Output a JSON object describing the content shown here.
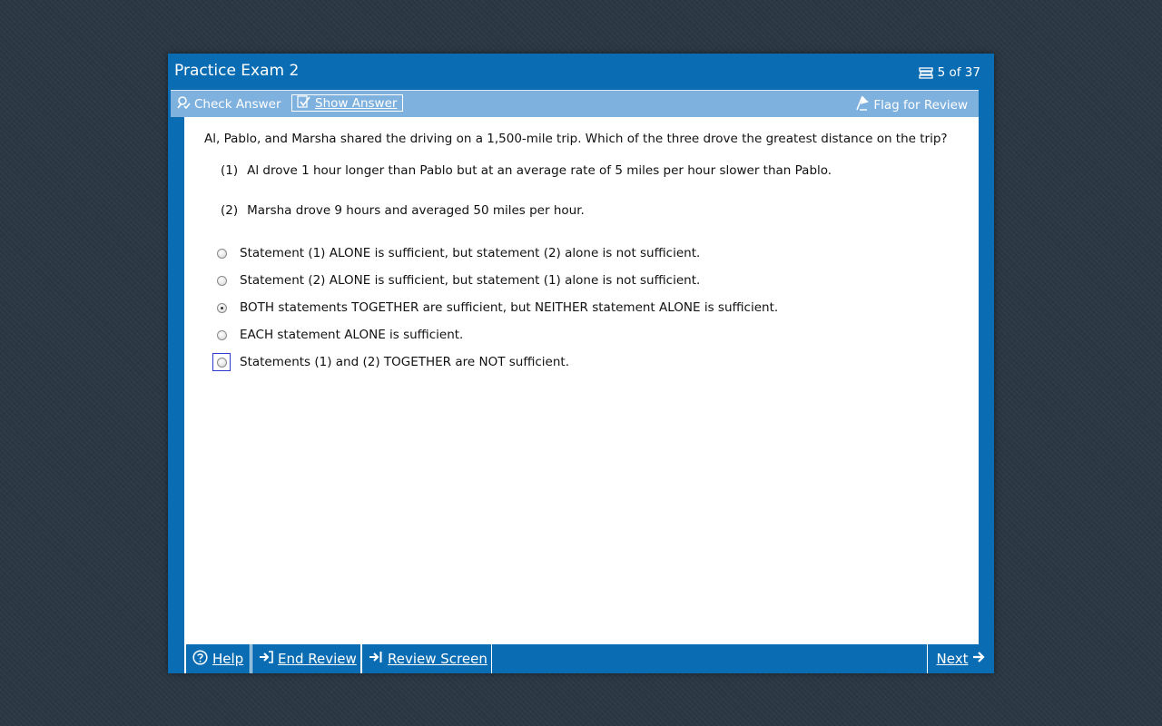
{
  "window": {
    "title": "Practice Exam 2",
    "counter": "5 of 37"
  },
  "toolbar": {
    "check_answer": "Check Answer",
    "show_answer": "Show Answer",
    "flag_for_review": "Flag for Review"
  },
  "question": {
    "text": "Al, Pablo, and Marsha shared the driving on a 1,500-mile trip. Which of the three drove the greatest distance on the trip?",
    "statements": [
      {
        "num": "(1)",
        "text": "Al drove 1 hour longer than Pablo but at an average rate of 5 miles per hour slower than Pablo."
      },
      {
        "num": "(2)",
        "text": "Marsha drove 9 hours and averaged 50 miles per hour."
      }
    ],
    "choices": [
      {
        "text": "Statement (1) ALONE is sufficient, but statement (2) alone is not sufficient.",
        "selected": false
      },
      {
        "text": "Statement (2) ALONE is sufficient, but statement (1) alone is not sufficient.",
        "selected": false
      },
      {
        "text": "BOTH statements TOGETHER are sufficient, but NEITHER statement ALONE is sufficient.",
        "selected": true
      },
      {
        "text": "EACH statement ALONE is sufficient.",
        "selected": false
      },
      {
        "text": "Statements (1) and (2) TOGETHER are NOT sufficient.",
        "selected": false
      }
    ]
  },
  "footer": {
    "help": "Help",
    "end_review": "End Review",
    "review_screen": "Review Screen",
    "next": "Next"
  },
  "colors": {
    "frame_blue": "#0a6db3",
    "toolbar_blue": "#7fb1de",
    "background": "#2b3844"
  },
  "icons": [
    "list-icon",
    "check-answer-icon",
    "show-answer-icon",
    "flag-icon",
    "help-icon",
    "end-review-icon",
    "review-screen-icon",
    "next-arrow-icon"
  ]
}
